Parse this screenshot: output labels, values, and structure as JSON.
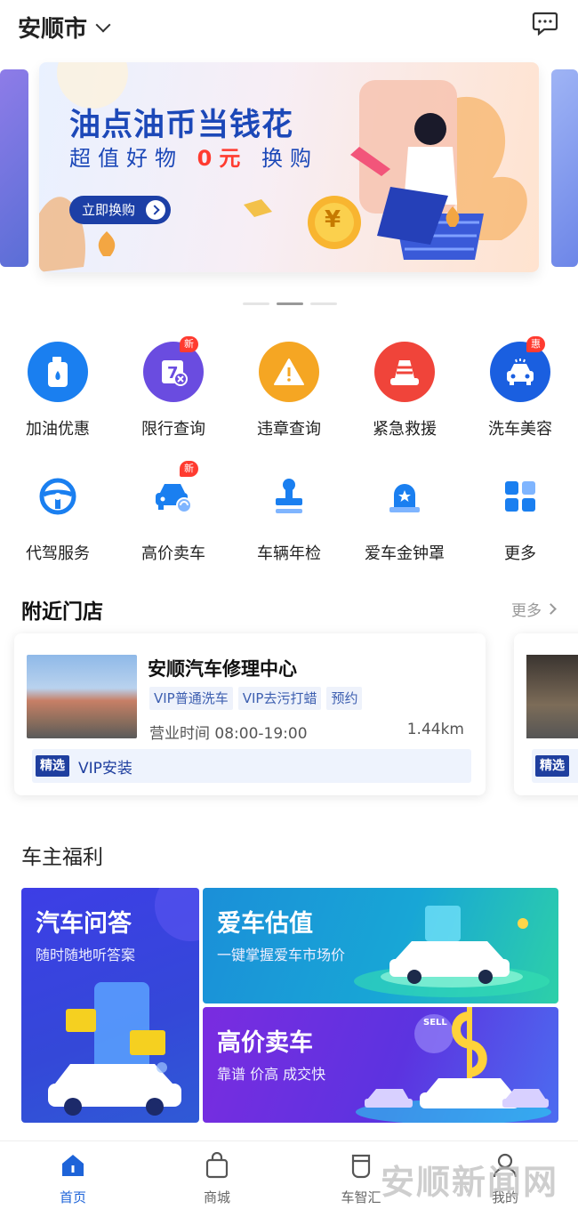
{
  "header": {
    "city": "安顺市"
  },
  "banner": {
    "title": "油点油币当钱花",
    "subtitle_pre": "超值好物",
    "subtitle_red": "0元",
    "subtitle_post": "换购",
    "button": "立即换购",
    "coin_symbol": "¥"
  },
  "services_row1": [
    {
      "label": "加油优惠",
      "icon": "fuel-can-icon",
      "color": "#1a7ff0",
      "badge": ""
    },
    {
      "label": "限行查询",
      "icon": "restriction-icon",
      "color": "#6a4ce0",
      "badge": "新"
    },
    {
      "label": "违章查询",
      "icon": "warning-icon",
      "color": "#f5a623",
      "badge": ""
    },
    {
      "label": "紧急救援",
      "icon": "sos-icon",
      "color": "#f0443a",
      "badge": ""
    },
    {
      "label": "洗车美容",
      "icon": "car-wash-icon",
      "color": "#1a5fe0",
      "badge": "惠"
    }
  ],
  "services_row2": [
    {
      "label": "代驾服务",
      "icon": "steering-wheel-icon",
      "badge": ""
    },
    {
      "label": "高价卖车",
      "icon": "car-sell-icon",
      "badge": "新"
    },
    {
      "label": "车辆年检",
      "icon": "stamp-icon",
      "badge": ""
    },
    {
      "label": "爱车金钟罩",
      "icon": "shield-bell-icon",
      "badge": ""
    },
    {
      "label": "更多",
      "icon": "grid-more-icon",
      "badge": ""
    }
  ],
  "nearby": {
    "title": "附近门店",
    "more": "更多",
    "store": {
      "name": "安顺汽车修理中心",
      "tags": [
        "VIP普通洗车",
        "VIP去污打蜡",
        "预约"
      ],
      "hours": "营业时间 08:00-19:00",
      "distance": "1.44km",
      "vip_badge": "精选",
      "vip_text": "VIP安装"
    },
    "store2": {
      "vip_badge": "精选"
    }
  },
  "benefits": {
    "title": "车主福利",
    "qa": {
      "title": "汽车问答",
      "subtitle": "随时随地听答案"
    },
    "valuation": {
      "title": "爱车估值",
      "subtitle": "一键掌握爱车市场价"
    },
    "sell": {
      "title": "高价卖车",
      "subtitle": "靠谱 价高 成交快",
      "sign": "SELL"
    }
  },
  "tabbar": [
    {
      "label": "首页",
      "icon": "home-icon",
      "active": true
    },
    {
      "label": "商城",
      "icon": "shopping-bag-icon",
      "active": false
    },
    {
      "label": "车智汇",
      "icon": "cup-icon",
      "active": false
    },
    {
      "label": "我的",
      "icon": "user-icon",
      "active": false
    }
  ],
  "watermark": "安顺新闻网",
  "colors": {
    "primary": "#1d63d8",
    "badge_red": "#ff3b30",
    "navy": "#1f3f9f"
  }
}
